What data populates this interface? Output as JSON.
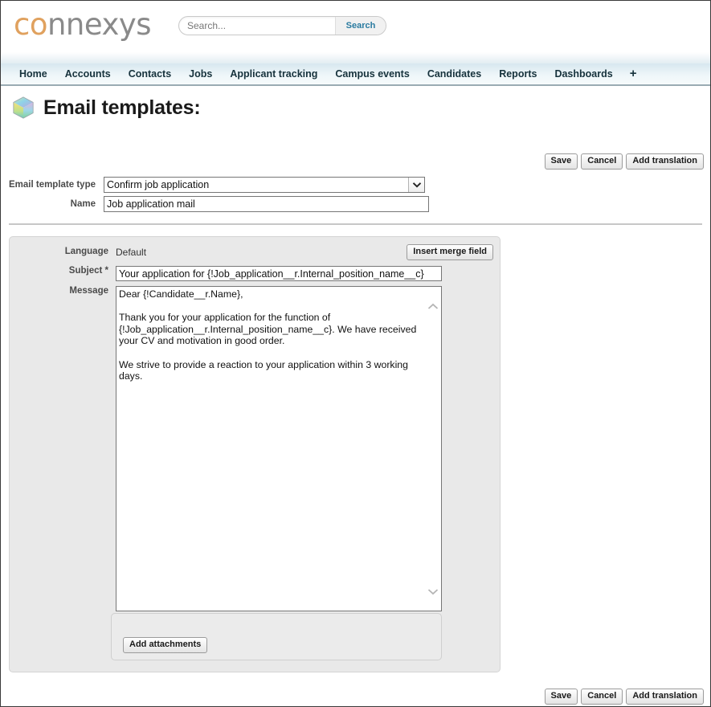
{
  "brand": {
    "logo_prefix": "co",
    "logo_suffix": "nnexys"
  },
  "search": {
    "placeholder": "Search...",
    "value": "",
    "button_label": "Search",
    "button_color": "#2a7ba0"
  },
  "nav": {
    "items": [
      {
        "label": "Home"
      },
      {
        "label": "Accounts"
      },
      {
        "label": "Contacts"
      },
      {
        "label": "Jobs"
      },
      {
        "label": "Applicant tracking"
      },
      {
        "label": "Campus events"
      },
      {
        "label": "Candidates"
      },
      {
        "label": "Reports"
      },
      {
        "label": "Dashboards"
      },
      {
        "label": "+"
      }
    ]
  },
  "page": {
    "title": "Email templates:",
    "icon": "cube-icon"
  },
  "actions": {
    "save_label": "Save",
    "cancel_label": "Cancel",
    "add_translation_label": "Add translation"
  },
  "top_form": {
    "template_type_label": "Email template type",
    "template_type_value": "Confirm job application",
    "template_type_options": [
      "Confirm job application"
    ],
    "name_label": "Name",
    "name_value": "Job application mail"
  },
  "panel": {
    "language_label": "Language",
    "language_value": "Default",
    "insert_merge_field_label": "Insert merge field",
    "subject_label": "Subject *",
    "subject_value": "Your application for {!Job_application__r.Internal_position_name__c}",
    "message_label": "Message",
    "message_value": "Dear {!Candidate__r.Name},\n\nThank you for your application for the function of {!Job_application__r.Internal_position_name__c}. We have received your CV and motivation in good order.\n\nWe strive to provide a reaction to your application within 3 working days.",
    "scroll_up_icon": "chevron-up-icon",
    "scroll_down_icon": "chevron-down-icon",
    "add_attachments_label": "Add attachments"
  },
  "colors": {
    "nav_text": "#16323c",
    "panel_bg": "#e9e9e9",
    "logo_orange": "#e0a15e",
    "logo_gray": "#8a8a8a"
  }
}
